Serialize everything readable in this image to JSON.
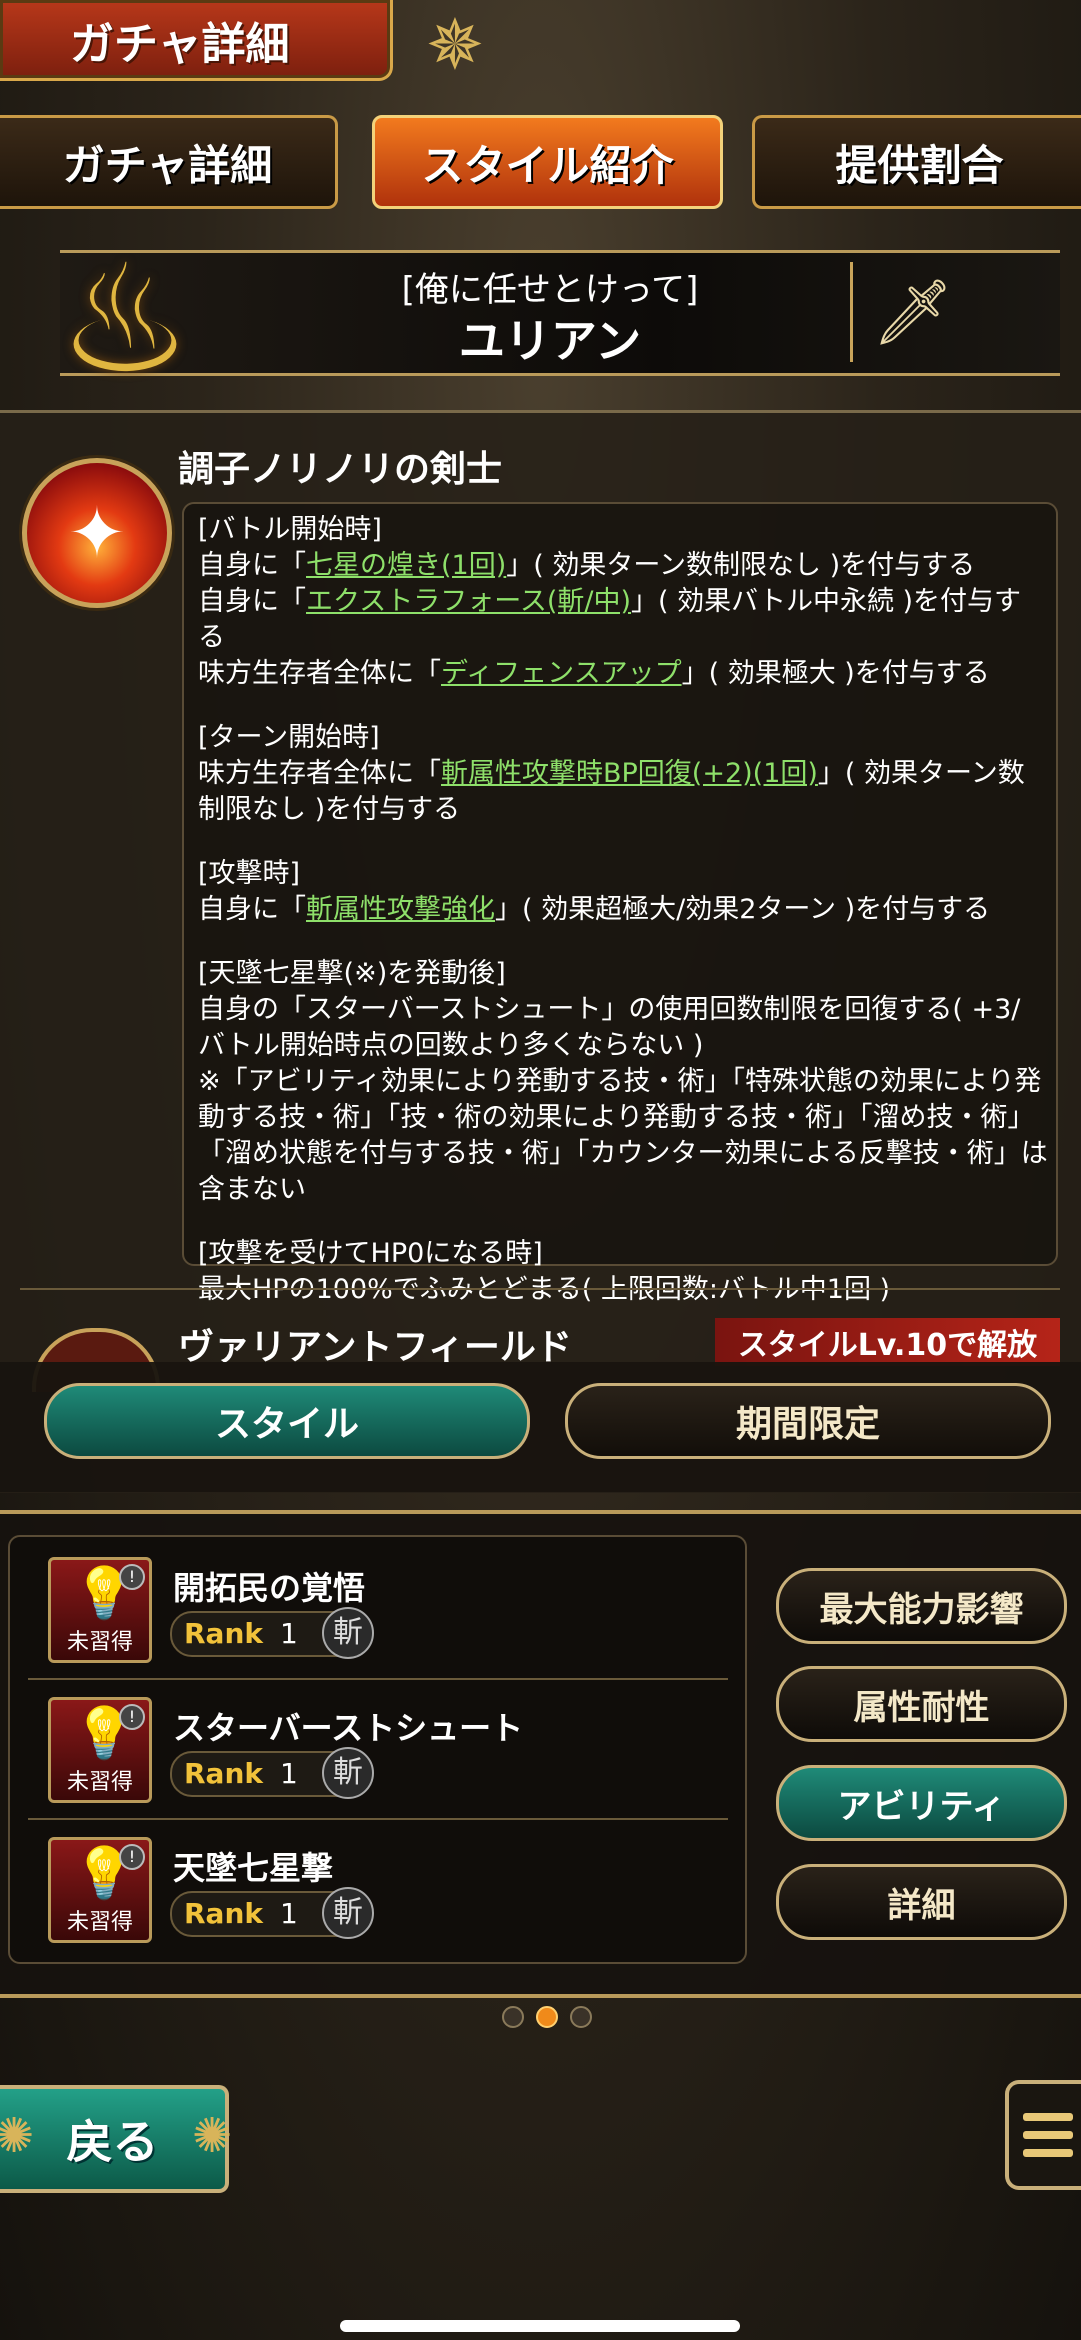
{
  "header": {
    "title": "ガチャ詳細"
  },
  "tabs": [
    {
      "label": "ガチャ詳細"
    },
    {
      "label": "スタイル紹介"
    },
    {
      "label": "提供割合"
    }
  ],
  "character": {
    "style_name": "[俺に任せとけって]",
    "name": "ユリアン"
  },
  "skill": {
    "title": "調子ノリノリの剣士",
    "sections": [
      {
        "heading": "[バトル開始時]",
        "lines": [
          {
            "pre": "自身に「",
            "hl": "七星の煌き(1回)",
            "post": "」( 効果ターン数制限なし )を付与する"
          },
          {
            "pre": "自身に「",
            "hl": "エクストラフォース(斬/中)",
            "post": "」( 効果バトル中永続 )を付与する"
          },
          {
            "pre": "味方生存者全体に「",
            "hl": "ディフェンスアップ",
            "post": "」( 効果極大 )を付与する"
          }
        ]
      },
      {
        "heading": "[ターン開始時]",
        "lines": [
          {
            "pre": "味方生存者全体に「",
            "hl": "斬属性攻撃時BP回復(+2)(1回)",
            "post": "」( 効果ターン数制限なし )を付与する"
          }
        ]
      },
      {
        "heading": "[攻撃時]",
        "lines": [
          {
            "pre": "自身に「",
            "hl": "斬属性攻撃強化",
            "post": "」( 効果超極大/効果2ターン )を付与する"
          }
        ]
      },
      {
        "heading": "[天墜七星撃(※)を発動後]",
        "lines": [
          {
            "pre": "自身の「スターバーストシュート」の使用回数制限を回復する( +3/バトル開始時点の回数より多くならない )",
            "hl": "",
            "post": ""
          },
          {
            "pre": "※「アビリティ効果により発動する技・術」「特殊状態の効果により発動する技・術」「技・術の効果により発動する技・術」「溜め技・術」「溜め状態を付与する技・術」「カウンター効果による反撃技・術」は含まない",
            "hl": "",
            "post": ""
          }
        ]
      },
      {
        "heading": "[攻撃を受けてHP0になる時]",
        "lines": [
          {
            "pre": "最大HPの100%でふみとどまる( 上限回数:バトル中1回 )",
            "hl": "",
            "post": ""
          }
        ]
      }
    ]
  },
  "skill2": {
    "title": "ヴァリアントフィールド",
    "unlock": "スタイルLv.10で解放"
  },
  "toggles": {
    "style": "スタイル",
    "limited": "期間限定"
  },
  "abilities": [
    {
      "name": "開拓民の覚悟",
      "rank_label": "Rank",
      "rank": "1",
      "status": "未習得",
      "attr": "斬"
    },
    {
      "name": "スターバーストシュート",
      "rank_label": "Rank",
      "rank": "1",
      "status": "未習得",
      "attr": "斬"
    },
    {
      "name": "天墜七星撃",
      "rank_label": "Rank",
      "rank": "1",
      "status": "未習得",
      "attr": "斬"
    }
  ],
  "side_buttons": [
    {
      "label": "最大能力影響"
    },
    {
      "label": "属性耐性"
    },
    {
      "label": "アビリティ"
    },
    {
      "label": "詳細"
    }
  ],
  "back_label": "戻る",
  "colors": {
    "accent_orange": "#f27a1e",
    "accent_teal": "#1f8a78",
    "highlight_green": "#8ee06a",
    "gold": "#c9a45a"
  }
}
